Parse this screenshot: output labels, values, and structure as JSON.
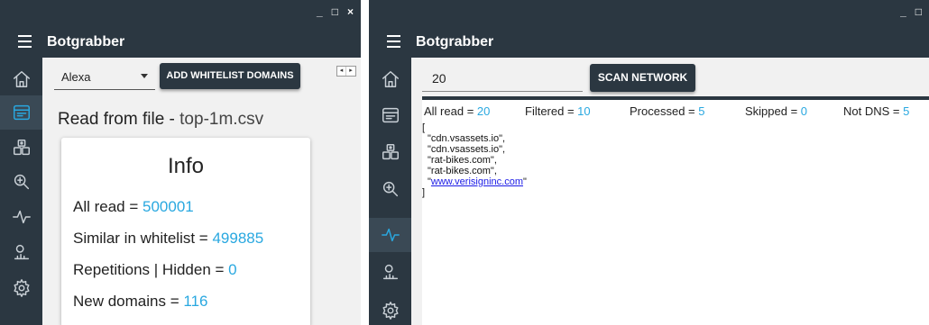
{
  "window1": {
    "controls": [
      "_",
      "□",
      "×"
    ],
    "app_title": "Botgrabber",
    "source_select": {
      "value": "Alexa"
    },
    "whitelist_button": "ADD WHITELIST DOMAINS",
    "scroll_arrows": [
      "◂",
      "▸"
    ],
    "read_from_file": {
      "prefix": "Read from file - ",
      "filename": "top-1m.csv"
    },
    "info_card": {
      "title": "Info",
      "lines": [
        {
          "label": "All read = ",
          "value": "500001"
        },
        {
          "label": "Similar in whitelist = ",
          "value": "499885"
        },
        {
          "label": "Repetitions | Hidden = ",
          "value": "0"
        },
        {
          "label": "New domains = ",
          "value": "116"
        }
      ]
    },
    "active_nav": "analysis",
    "nav_icons": [
      "home-icon",
      "browser-icon",
      "robot-icon",
      "bug-search-icon",
      "pulse-icon",
      "stats-icon",
      "gear-icon"
    ]
  },
  "window2": {
    "controls": [
      "_",
      "□"
    ],
    "app_title": "Botgrabber",
    "scan_input": {
      "value": "20"
    },
    "scan_button": "SCAN NETWORK",
    "active_nav": "pulse",
    "stats": [
      {
        "label": "All read = ",
        "value": "20"
      },
      {
        "label": "Filtered = ",
        "value": "10"
      },
      {
        "label": "Processed = ",
        "value": "5"
      },
      {
        "label": "Skipped = ",
        "value": "0"
      },
      {
        "label": "Not DNS = ",
        "value": "5"
      }
    ],
    "output": {
      "open": "[",
      "entries": [
        "\"cdn.vsassets.io\",",
        "\"cdn.vsassets.io\",",
        "\"rat-bikes.com\",",
        "\"rat-bikes.com\","
      ],
      "link_prefix": "\"",
      "link": "www.verisigninc.com",
      "link_suffix": "\"",
      "close": "]"
    }
  },
  "colors": {
    "dark": "#2b3741",
    "accent": "#29a8e0",
    "content_bg": "#f1f1f1"
  }
}
